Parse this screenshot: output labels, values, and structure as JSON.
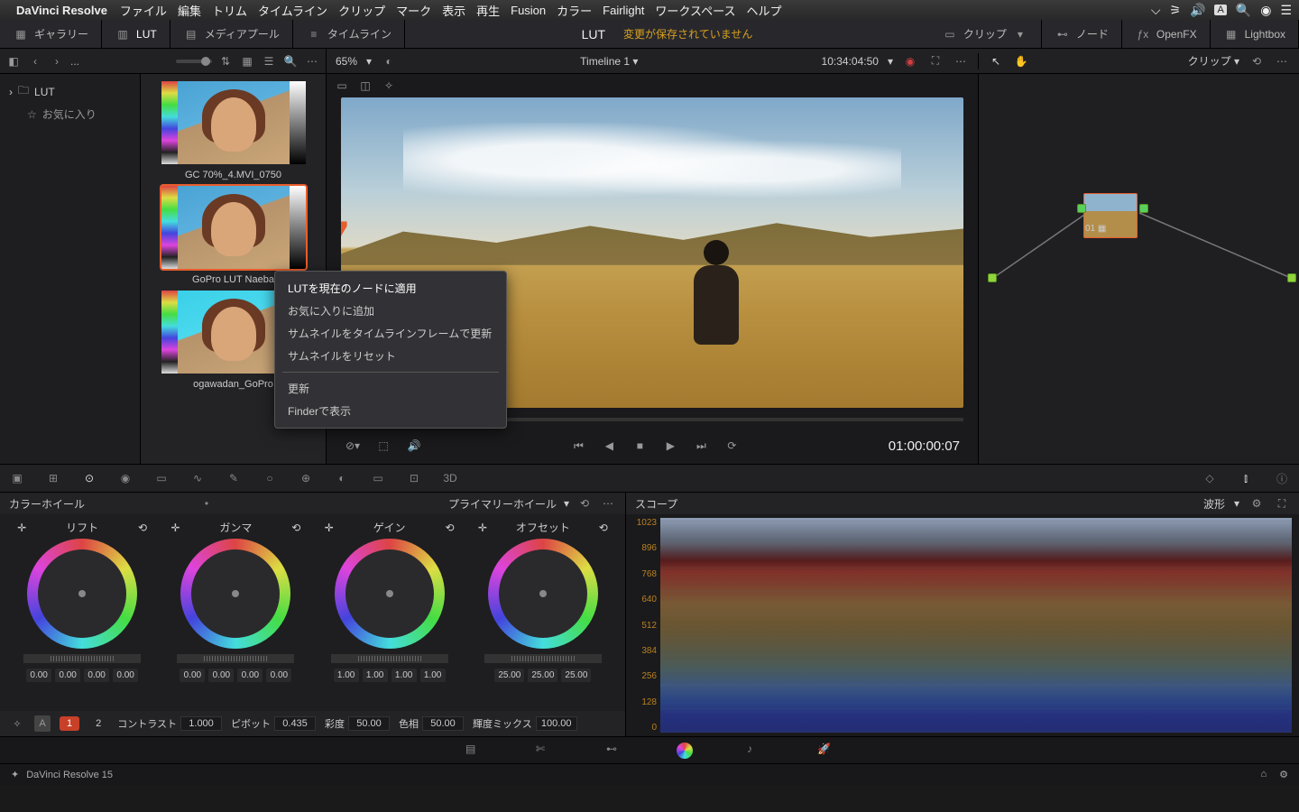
{
  "menubar": {
    "app": "DaVinci Resolve",
    "items": [
      "ファイル",
      "編集",
      "トリム",
      "タイムライン",
      "クリップ",
      "マーク",
      "表示",
      "再生",
      "Fusion",
      "カラー",
      "Fairlight",
      "ワークスペース",
      "ヘルプ"
    ],
    "input_badge": "A"
  },
  "topbar": {
    "gallery": "ギャラリー",
    "lut": "LUT",
    "mediapool": "メディアプール",
    "timeline": "タイムライン",
    "title": "LUT",
    "warn": "変更が保存されていません",
    "clips": "クリップ",
    "nodes": "ノード",
    "openfx": "OpenFX",
    "lightbox": "Lightbox"
  },
  "row2": {
    "breadcrumb": "...",
    "zoom": "65%",
    "timeline": "Timeline 1",
    "timecode": "10:34:04:50",
    "clips": "クリップ"
  },
  "sidebar": {
    "lut": "LUT",
    "fav": "お気に入り"
  },
  "luts": [
    {
      "name": "GC 70%_4.MVI_0750"
    },
    {
      "name": "GoPro LUT Naeba"
    },
    {
      "name": "ogawadan_GoPro"
    }
  ],
  "context_menu": {
    "items": [
      "LUTを現在のノードに適用",
      "お気に入りに追加",
      "サムネイルをタイムラインフレームで更新",
      "サムネイルをリセット",
      "更新",
      "Finderで表示"
    ]
  },
  "viewer": {
    "timecode": "01:00:00:07"
  },
  "nodes": {
    "dropdown": "クリップ",
    "label": "01"
  },
  "wheels_panel": {
    "title": "カラーホイール",
    "mode": "プライマリーホイール",
    "wheels": [
      {
        "name": "リフト",
        "vals": [
          "0.00",
          "0.00",
          "0.00",
          "0.00"
        ]
      },
      {
        "name": "ガンマ",
        "vals": [
          "0.00",
          "0.00",
          "0.00",
          "0.00"
        ]
      },
      {
        "name": "ゲイン",
        "vals": [
          "1.00",
          "1.00",
          "1.00",
          "1.00"
        ]
      },
      {
        "name": "オフセット",
        "vals": [
          "25.00",
          "25.00",
          "25.00"
        ]
      }
    ],
    "foot": {
      "tab1": "1",
      "tab2": "2",
      "contrast_l": "コントラスト",
      "contrast": "1.000",
      "pivot_l": "ピボット",
      "pivot": "0.435",
      "sat_l": "彩度",
      "sat": "50.00",
      "hue_l": "色相",
      "hue": "50.00",
      "lummix_l": "輝度ミックス",
      "lummix": "100.00"
    }
  },
  "scope": {
    "title": "スコープ",
    "mode": "波形",
    "ticks": [
      "1023",
      "896",
      "768",
      "640",
      "512",
      "384",
      "256",
      "128",
      "0"
    ]
  },
  "statusbar": {
    "version": "DaVinci Resolve 15"
  },
  "annotation": {
    "seven": "7"
  }
}
